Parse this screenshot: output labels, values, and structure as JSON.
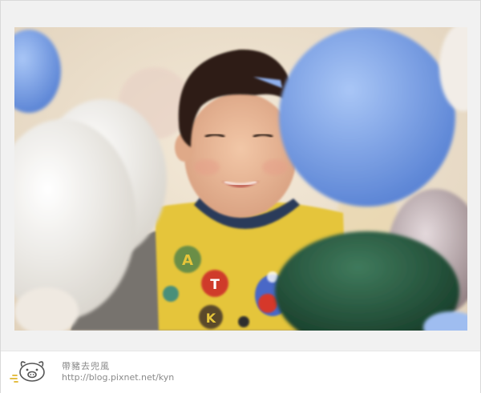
{
  "blog": {
    "title": "帶豬去兜風",
    "url": "http://blog.pixnet.net/kyn"
  },
  "photo": {
    "subject": "smiling child among balloons",
    "shirt_letters": [
      "A",
      "T",
      "K"
    ]
  },
  "colors": {
    "frame_bg": "#f1f1f1",
    "balloon_blue": "#7fa6ea",
    "balloon_white": "#f3f1ec",
    "balloon_green": "#24583d",
    "balloon_silver": "#b9a7aa",
    "shirt_yellow": "#e5c53a"
  },
  "icons": {
    "logo": "pig-logo-icon"
  }
}
